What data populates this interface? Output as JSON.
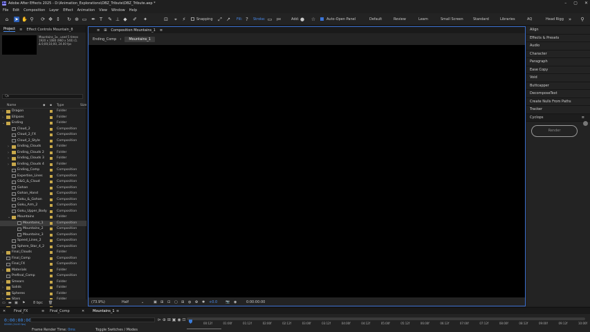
{
  "app": {
    "title": "Adobe After Effects 2025 - D:\\Animation_Explorations\\DBZ_Tribute\\DBZ_Tribute.aep *",
    "icon_label": "Ae"
  },
  "menu": [
    "File",
    "Edit",
    "Composition",
    "Layer",
    "Effect",
    "Animation",
    "View",
    "Window",
    "Help"
  ],
  "toolbar": {
    "snapping": "Snapping",
    "fill": "Fill:",
    "stroke": "Stroke:",
    "stroke_unit": "px",
    "add": "Add:",
    "auto_open": "Auto-Open Panel",
    "workspaces": [
      "Default",
      "Review",
      "Learn",
      "Small Screen",
      "Standard",
      "Libraries",
      "AQ",
      "Head Rigg"
    ]
  },
  "project": {
    "tab_project": "Project",
    "tab_effects": "Effect Controls Mountain_8",
    "info": [
      "Mountains_1▾ , used 5 times",
      "1920 x 1080 (960 x 540) (1.",
      "Δ 0;00;10;00, 24.00 fps"
    ],
    "search_placeholder": "Q▸",
    "columns": {
      "name": "Name",
      "type": "Type",
      "size": "Size"
    },
    "bpc": "8 bpc",
    "items": [
      {
        "name": "Dragon",
        "type": "Folder",
        "kind": "folder",
        "level": 0,
        "tw": "›"
      },
      {
        "name": "Ellipses",
        "type": "Folder",
        "kind": "folder",
        "level": 0,
        "tw": "›"
      },
      {
        "name": "Ending",
        "type": "Folder",
        "kind": "folder",
        "level": 0,
        "tw": "⌄"
      },
      {
        "name": "Cloud_2",
        "type": "Composition",
        "kind": "comp",
        "level": 1,
        "tw": ""
      },
      {
        "name": "Cloud_2_FX",
        "type": "Composition",
        "kind": "comp",
        "level": 1,
        "tw": ""
      },
      {
        "name": "Cloud_2_Style",
        "type": "Composition",
        "kind": "comp",
        "level": 1,
        "tw": ""
      },
      {
        "name": "Ending_Clouds",
        "type": "Folder",
        "kind": "folder",
        "level": 1,
        "tw": "›"
      },
      {
        "name": "Ending_Clouds 2",
        "type": "Folder",
        "kind": "folder",
        "level": 1,
        "tw": "›"
      },
      {
        "name": "Ending_Clouds 3",
        "type": "Folder",
        "kind": "folder",
        "level": 1,
        "tw": "›"
      },
      {
        "name": "Ending_Clouds 4",
        "type": "Folder",
        "kind": "folder",
        "level": 1,
        "tw": "›"
      },
      {
        "name": "Ending_Comp",
        "type": "Composition",
        "kind": "comp",
        "level": 1,
        "tw": ""
      },
      {
        "name": "Expertise_Lines",
        "type": "Composition",
        "kind": "comp",
        "level": 1,
        "tw": ""
      },
      {
        "name": "G&G_&_Cloud",
        "type": "Composition",
        "kind": "comp",
        "level": 1,
        "tw": ""
      },
      {
        "name": "Gohan",
        "type": "Composition",
        "kind": "comp",
        "level": 1,
        "tw": ""
      },
      {
        "name": "Gohan_Hand",
        "type": "Composition",
        "kind": "comp",
        "level": 1,
        "tw": ""
      },
      {
        "name": "Goku_&_Gohan",
        "type": "Composition",
        "kind": "comp",
        "level": 1,
        "tw": ""
      },
      {
        "name": "Goku_Arm_2",
        "type": "Composition",
        "kind": "comp",
        "level": 1,
        "tw": ""
      },
      {
        "name": "Goku_Upper_Body",
        "type": "Composition",
        "kind": "comp",
        "level": 1,
        "tw": ""
      },
      {
        "name": "Mountains",
        "type": "Folder",
        "kind": "folder",
        "level": 1,
        "tw": "⌄"
      },
      {
        "name": "Mountains_1",
        "type": "Composition",
        "kind": "comp",
        "level": 2,
        "tw": "",
        "selected": true
      },
      {
        "name": "Mountains_2",
        "type": "Composition",
        "kind": "comp",
        "level": 2,
        "tw": ""
      },
      {
        "name": "Mountains_3",
        "type": "Composition",
        "kind": "comp",
        "level": 2,
        "tw": ""
      },
      {
        "name": "Speed_Lines_2",
        "type": "Composition",
        "kind": "comp",
        "level": 1,
        "tw": ""
      },
      {
        "name": "Sphere_Star_4_2",
        "type": "Composition",
        "kind": "comp",
        "level": 1,
        "tw": ""
      },
      {
        "name": "Final_Clouds",
        "type": "Folder",
        "kind": "folder",
        "level": 0,
        "tw": "›"
      },
      {
        "name": "Final_Comp",
        "type": "Composition",
        "kind": "comp",
        "level": 0,
        "tw": ""
      },
      {
        "name": "Final_FX",
        "type": "Composition",
        "kind": "comp",
        "level": 0,
        "tw": ""
      },
      {
        "name": "Materials",
        "type": "Folder",
        "kind": "folder",
        "level": 0,
        "tw": "›"
      },
      {
        "name": "Prefinal_Comp",
        "type": "Composition",
        "kind": "comp",
        "level": 0,
        "tw": ""
      },
      {
        "name": "Smears",
        "type": "Folder",
        "kind": "folder",
        "level": 0,
        "tw": "›"
      },
      {
        "name": "Solids",
        "type": "Folder",
        "kind": "folder",
        "level": 0,
        "tw": "›"
      },
      {
        "name": "Spheres",
        "type": "Folder",
        "kind": "folder",
        "level": 0,
        "tw": "›"
      },
      {
        "name": "Stars",
        "type": "Folder",
        "kind": "folder",
        "level": 0,
        "tw": "›"
      },
      {
        "name": "Title",
        "type": "Folder",
        "kind": "folder",
        "level": 0,
        "tw": "›"
      },
      {
        "name": "Xtra_Clouds",
        "type": "Folder",
        "kind": "folder",
        "level": 0,
        "tw": "›"
      },
      {
        "name": "Z",
        "type": "Folder",
        "kind": "folder",
        "level": 0,
        "tw": "›"
      }
    ],
    "colors": {
      "folder_label": "#c8a84a",
      "comp_label": "#c8a84a",
      "selected_row": "#3b3b3b"
    }
  },
  "viewer": {
    "tab": "Composition Mountains_1",
    "crumbs": [
      "Ending_Comp",
      "Mountains_1"
    ],
    "zoom": "(73.9%)",
    "resolution": "Half",
    "exposure": "+0.0",
    "timecode": "0:00:00:00"
  },
  "right_panel": {
    "items": [
      "Align",
      "Effects & Presets",
      "Audio",
      "Character",
      "Paragraph",
      "Ease Copy",
      "Void",
      "Buttcapper",
      "DecomposeText",
      "Create Nulls From Paths",
      "Tracker"
    ],
    "cyclops": "Cyclops",
    "render": "Render"
  },
  "timeline": {
    "tabs": [
      "Final_FX",
      "Final_Comp",
      "Mountains_1"
    ],
    "timecode": "0:00:00:00",
    "fps": "00000 (24.00 fps)",
    "ticks": [
      "00:12f",
      "01:00f",
      "01:12f",
      "02:00f",
      "02:12f",
      "03:00f",
      "03:12f",
      "04:00f",
      "04:12f",
      "05:00f",
      "05:12f",
      "06:00f",
      "06:12f",
      "07:00f",
      "07:12f",
      "08:00f",
      "08:12f",
      "09:00f",
      "09:12f",
      "10:00f"
    ],
    "render_time_label": "Frame Render Time:",
    "render_time_value": "0ms",
    "toggle": "Toggle Switches / Modes",
    "accent": "#3f8ef0"
  }
}
